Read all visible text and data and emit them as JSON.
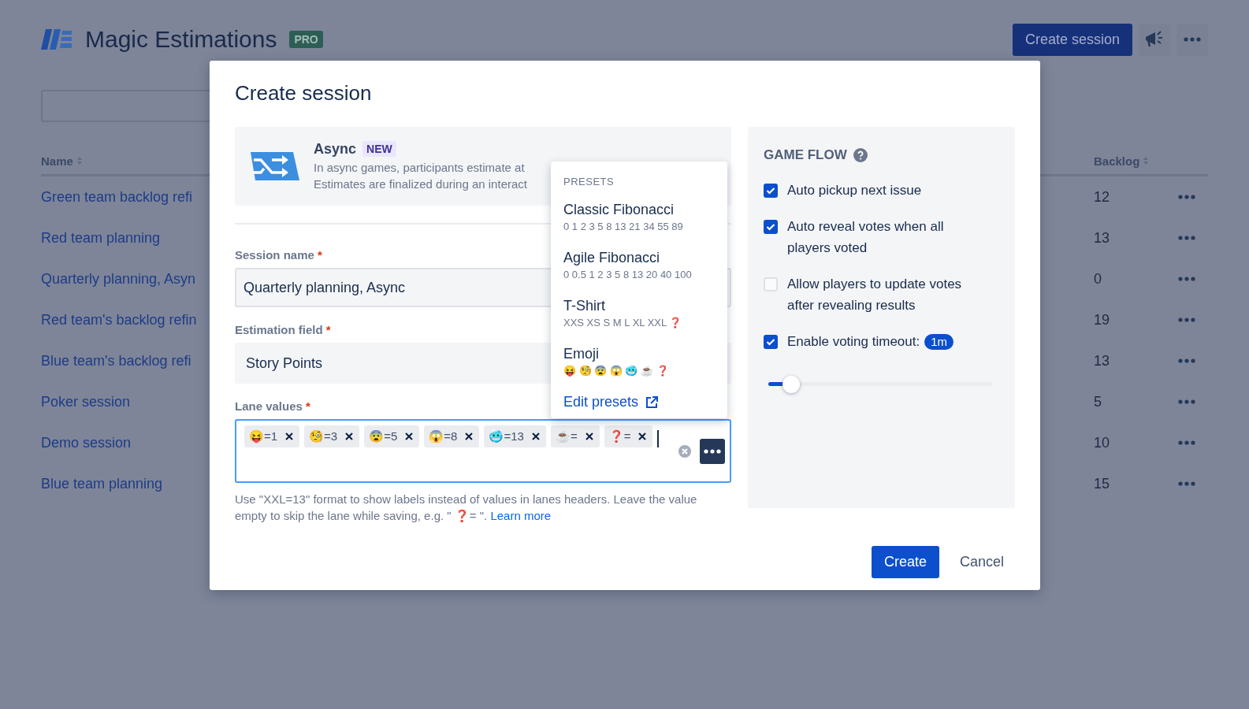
{
  "app": {
    "title": "Magic Estimations",
    "badge": "PRO",
    "create_button": "Create session"
  },
  "table": {
    "columns": [
      "Name",
      "Backlog"
    ],
    "rows": [
      {
        "name": "Green team backlog refi",
        "backlog": "12"
      },
      {
        "name": "Red team planning",
        "backlog": "13"
      },
      {
        "name": "Quarterly planning, Asyn",
        "backlog": "0"
      },
      {
        "name": "Red team's backlog refin",
        "backlog": "19"
      },
      {
        "name": "Blue team's backlog refi",
        "backlog": "13"
      },
      {
        "name": "Poker session",
        "backlog": "5"
      },
      {
        "name": "Demo session",
        "backlog": "10"
      },
      {
        "name": "Blue team planning",
        "backlog": "15"
      }
    ]
  },
  "modal": {
    "title": "Create session",
    "mode": {
      "title": "Async",
      "badge": "NEW",
      "lines": [
        "In async games, participants estimate at",
        "Estimates are finalized during an interact"
      ]
    },
    "session_name": {
      "label": "Session name",
      "mark": "*",
      "value": "Quarterly planning, Async"
    },
    "estimation_field": {
      "label": "Estimation field",
      "mark": "*",
      "value": "Story Points"
    },
    "lane_values": {
      "label": "Lane values",
      "mark": "*",
      "tags": [
        "😝=1",
        "🧐=3",
        "😨=5",
        "😱=8",
        "🥶=13",
        "☕=",
        "❓="
      ]
    },
    "help": "Use \"XXL=13\" format to show labels instead of values in lanes headers. Leave the value empty to skip the lane while saving, e.g. \" ❓= \".",
    "help_link": "Learn more",
    "presets": {
      "heading": "PRESETS",
      "items": [
        {
          "name": "Classic Fibonacci",
          "values": "0 1 2 3 5 8 13 21 34 55 89"
        },
        {
          "name": "Agile Fibonacci",
          "values": "0 0.5 1 2 3 5 8 13 20 40 100"
        },
        {
          "name": "T-Shirt",
          "values": "XXS XS S M L XL XXL ❓"
        },
        {
          "name": "Emoji",
          "values": "😝 🧐 😨 😱 🥶 ☕ ❓"
        }
      ],
      "edit_link": "Edit presets"
    },
    "game_flow": {
      "title": "GAME FLOW",
      "options": [
        {
          "label": "Auto pickup next issue",
          "checked": true
        },
        {
          "label": "Auto reveal votes when all players voted",
          "checked": true
        },
        {
          "label": "Allow players to update votes after revealing results",
          "checked": false
        },
        {
          "label": "Enable voting timeout:",
          "checked": true,
          "badge": "1m"
        }
      ],
      "slider": {
        "level": 0.1
      }
    },
    "buttons": {
      "create": "Create",
      "cancel": "Cancel"
    }
  }
}
